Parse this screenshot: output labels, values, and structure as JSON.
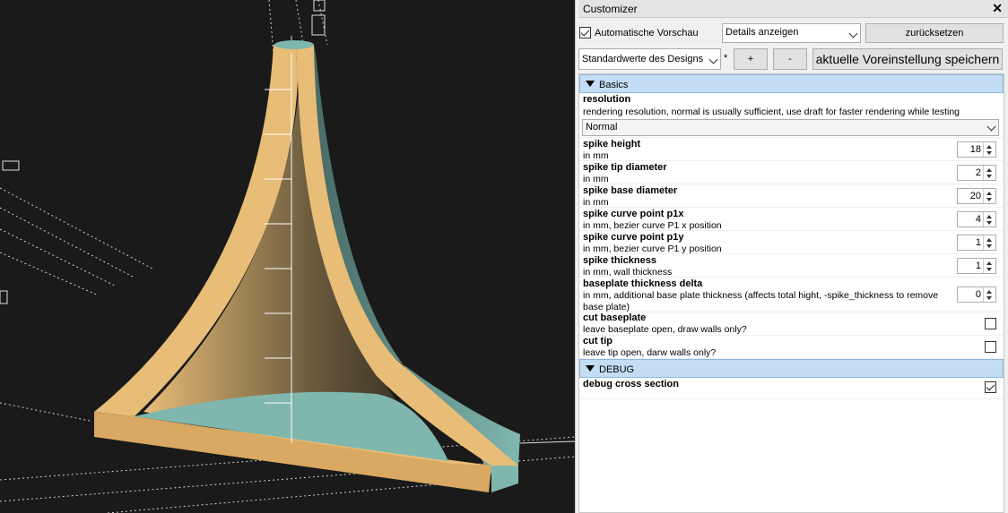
{
  "panel": {
    "title": "Customizer",
    "close_glyph": "✕",
    "auto_preview_label": "Automatische Vorschau",
    "auto_preview_checked": true,
    "details_select": "Details anzeigen",
    "reset_label": "zurücksetzen",
    "preset_select": "Standardwerte des Designs",
    "preset_modified_marker": "*",
    "add_label": "+",
    "remove_label": "-",
    "save_preset_label": "aktuelle Voreinstellung speichern"
  },
  "groups": {
    "basics": "Basics",
    "debug": "DEBUG"
  },
  "params": {
    "resolution": {
      "name": "resolution",
      "desc": "rendering resolution, normal is usually sufficient, use draft for faster rendering while testing",
      "value": "Normal"
    },
    "spike_height": {
      "name": "spike height",
      "desc": "in mm",
      "value": "18"
    },
    "spike_tip_diameter": {
      "name": "spike tip diameter",
      "desc": "in mm",
      "value": "2"
    },
    "spike_base_diameter": {
      "name": "spike base diameter",
      "desc": "in mm",
      "value": "20"
    },
    "spike_curve_p1x": {
      "name": "spike curve point p1x",
      "desc": "in mm, bezier curve P1 x position",
      "value": "4"
    },
    "spike_curve_p1y": {
      "name": "spike curve point p1y",
      "desc": "in mm, bezier curve P1 y position",
      "value": "1"
    },
    "spike_thickness": {
      "name": "spike thickness",
      "desc": "in mm, wall thickness",
      "value": "1"
    },
    "baseplate_thickness_delta": {
      "name": "baseplate thickness delta",
      "desc_line1": "in mm, additional base plate thickness (affects total hight, -spike_thickness to remove",
      "desc_line2": "base plate)",
      "value": "0"
    },
    "cut_baseplate": {
      "name": "cut baseplate",
      "desc": "leave baseplate open, draw walls only?",
      "checked": false
    },
    "cut_tip": {
      "name": "cut tip",
      "desc": "leave tip open, darw walls only?",
      "checked": false
    },
    "debug_cross_section": {
      "name": "debug cross section",
      "checked": true
    }
  },
  "colors": {
    "viewport_bg": "#1a1a1a",
    "model_face": "#e8bd78",
    "model_cut": "#7fb7ae",
    "group_header": "#c4ddf5"
  }
}
